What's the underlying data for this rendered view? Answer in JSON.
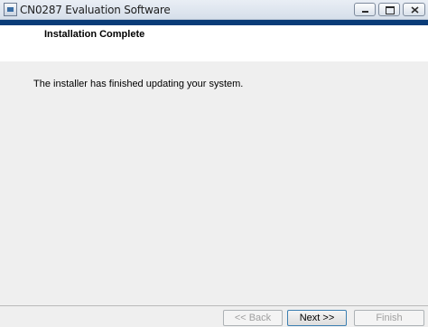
{
  "window": {
    "title": "CN0287 Evaluation Software",
    "app_icon": "installer-window-icon",
    "controls": {
      "minimize_icon": "minimize-icon",
      "maximize_icon": "maximize-icon",
      "close_icon": "close-icon"
    }
  },
  "colors": {
    "accent_bar": "#0a3c78",
    "content_background": "#efefef",
    "header_background": "#ffffff"
  },
  "header": {
    "title": "Installation Complete"
  },
  "content": {
    "message": "The installer has finished updating your system."
  },
  "footer": {
    "back_label": "<< Back",
    "next_label": "Next >>",
    "finish_label": "Finish",
    "back_enabled": false,
    "next_enabled": true,
    "finish_enabled": false
  }
}
